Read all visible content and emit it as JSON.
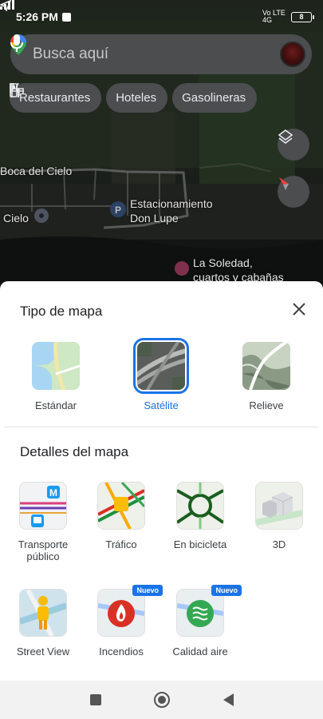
{
  "status_bar": {
    "time": "5:26 PM",
    "network": "Vo LTE 4G",
    "battery": "8"
  },
  "search": {
    "placeholder": "Busca aquí",
    "icons": [
      "maps-pin-icon",
      "mic-icon",
      "avatar"
    ]
  },
  "chips": [
    {
      "label": "Restaurantes",
      "icon": "fork-knife-icon"
    },
    {
      "label": "Hoteles",
      "icon": "bed-icon"
    },
    {
      "label": "Gasolineras",
      "icon": "gas-pump-icon"
    }
  ],
  "map_labels": {
    "boca": "Boca del Cielo",
    "cielo": "Cielo",
    "parking_line1": "Estacionamiento",
    "parking_line2": "Don Lupe",
    "soledad_line1": "La Soledad,",
    "soledad_line2": "cuartos y cabañas"
  },
  "sheet": {
    "title": "Tipo de mapa",
    "map_types": [
      {
        "label": "Estándar",
        "selected": false
      },
      {
        "label": "Satélite",
        "selected": true
      },
      {
        "label": "Relieve",
        "selected": false
      }
    ],
    "details_title": "Detalles del mapa",
    "details": [
      {
        "label": "Transporte público",
        "line1": "Transporte",
        "line2": "público"
      },
      {
        "label": "Tráfico"
      },
      {
        "label": "En bicicleta"
      },
      {
        "label": "3D"
      },
      {
        "label": "Street View"
      },
      {
        "label": "Incendios",
        "badge": "Nuevo"
      },
      {
        "label": "Calidad aire",
        "badge": "Nuevo"
      }
    ]
  },
  "colors": {
    "accent": "#1a73e8",
    "sheet_bg": "#ffffff",
    "chip_bg": "#4b4d4f"
  }
}
